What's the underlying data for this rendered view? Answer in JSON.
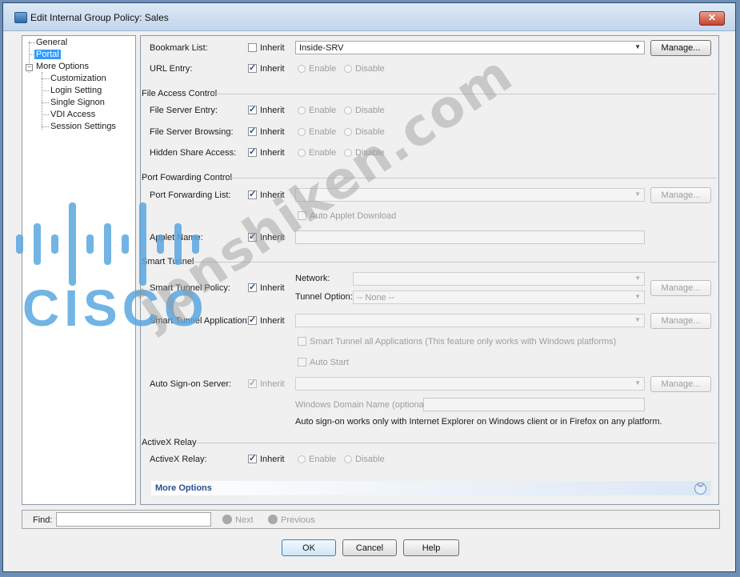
{
  "window": {
    "title": "Edit Internal Group Policy: Sales",
    "close_label": "✕"
  },
  "tree": {
    "items": [
      {
        "label": "General"
      },
      {
        "label": "Portal"
      },
      {
        "label": "More Options"
      },
      {
        "label": "Customization"
      },
      {
        "label": "Login Setting"
      },
      {
        "label": "Single Signon"
      },
      {
        "label": "VDI Access"
      },
      {
        "label": "Session Settings"
      }
    ],
    "expander": "−"
  },
  "form": {
    "inherit_label": "Inherit",
    "enable_label": "Enable",
    "disable_label": "Disable",
    "manage_label": "Manage...",
    "bookmark_list": {
      "label": "Bookmark List:",
      "value": "Inside-SRV"
    },
    "url_entry": {
      "label": "URL Entry:"
    },
    "file_access_section": "File Access Control",
    "file_server_entry": {
      "label": "File Server Entry:"
    },
    "file_server_browsing": {
      "label": "File Server Browsing:"
    },
    "hidden_share_access": {
      "label": "Hidden Share Access:"
    },
    "port_forwarding_section": "Port Fowarding Control",
    "port_forwarding_list": {
      "label": "Port Forwarding List:"
    },
    "auto_applet_download": "Auto Applet Download",
    "applet_name": {
      "label": "Applet Name:"
    },
    "smart_tunnel_section": "Smart Tunnel",
    "smart_tunnel_policy": {
      "label": "Smart Tunnel Policy:",
      "network_label": "Network:",
      "tunnel_option_label": "Tunnel Option:",
      "tunnel_option_value": "-- None --"
    },
    "smart_tunnel_application": {
      "label": "Smart Tunnel Application:"
    },
    "smart_tunnel_all_apps": "Smart Tunnel all Applications (This feature only works with Windows platforms)",
    "auto_start": "Auto Start",
    "auto_signon_server": {
      "label": "Auto Sign-on Server:",
      "windows_domain_label": "Windows Domain Name (optional):",
      "note": "Auto sign-on works only with Internet Explorer on Windows client or in Firefox on any platform."
    },
    "activex_section": "ActiveX Relay",
    "activex_relay": {
      "label": "ActiveX Relay:"
    },
    "more_options": "More Options",
    "more_options_icon": "chevron-double-down-icon"
  },
  "find": {
    "label": "Find:",
    "next": "Next",
    "previous": "Previous"
  },
  "buttons": {
    "ok": "OK",
    "cancel": "Cancel",
    "help": "Help"
  },
  "watermark": {
    "logo_text": "CISCO",
    "site": "jpnshiken.com"
  },
  "colors": {
    "selection": "#3399ff",
    "watermark_logo": "#5aa7e0"
  }
}
